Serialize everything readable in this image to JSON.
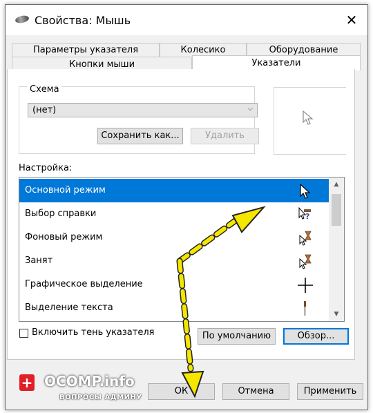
{
  "window": {
    "title": "Свойства: Мышь",
    "close_glyph": "✕"
  },
  "tabs_top": [
    "Параметры указателя",
    "Колесико",
    "Оборудование"
  ],
  "tabs_bottom": [
    "Кнопки мыши",
    "Указатели"
  ],
  "scheme": {
    "label": "Схема",
    "value": "(нет)",
    "save_label": "Сохранить как...",
    "delete_label": "Удалить"
  },
  "customize": {
    "label": "Настройка:",
    "items": [
      {
        "label": "Основной режим",
        "icon": "arrow-cursor-icon"
      },
      {
        "label": "Выбор справки",
        "icon": "help-cursor-icon"
      },
      {
        "label": "Фоновый режим",
        "icon": "working-in-background-cursor-icon"
      },
      {
        "label": "Занят",
        "icon": "busy-cursor-icon"
      },
      {
        "label": "Графическое выделение",
        "icon": "precision-select-cursor-icon"
      },
      {
        "label": "Выделение текста",
        "icon": "text-select-cursor-icon"
      }
    ]
  },
  "shadow_checkbox": {
    "label": "Включить тень указателя",
    "checked": false
  },
  "buttons": {
    "default_label": "По умолчанию",
    "browse_label": "Обзор...",
    "ok_label": "ОК",
    "cancel_label": "Отмена",
    "apply_label": "Применить"
  },
  "watermark": {
    "main": "OCOMP.info",
    "sub": "ВОПРОСЫ АДМИНУ"
  },
  "colors": {
    "selection": "#0078d7",
    "annotation": "#f5e600"
  }
}
